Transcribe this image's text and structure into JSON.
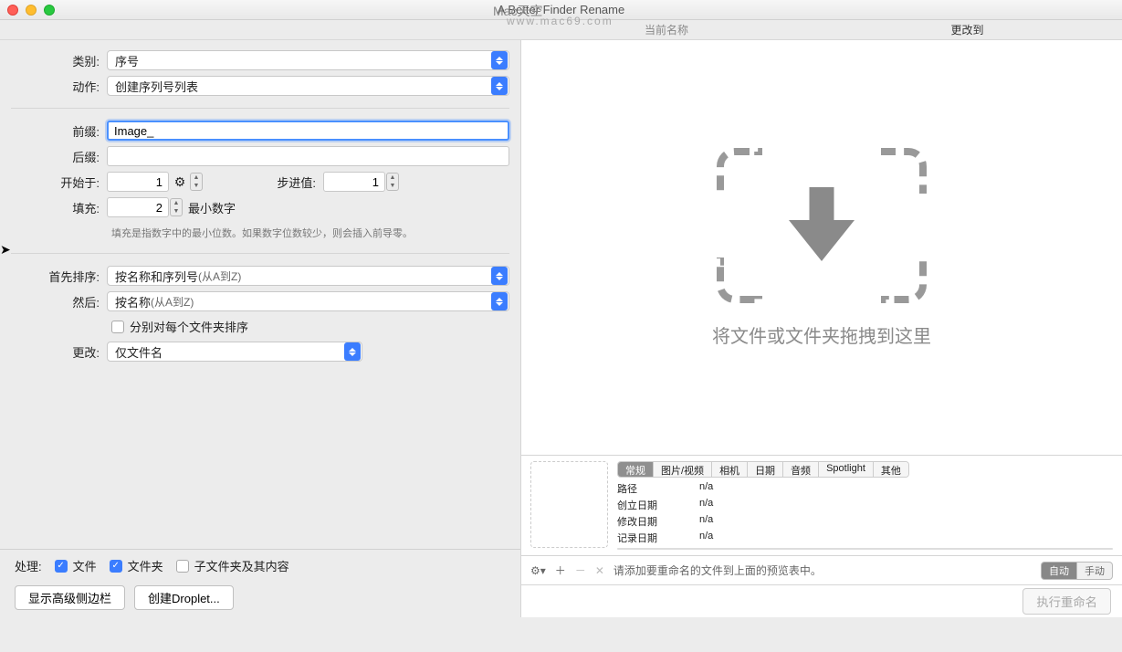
{
  "window": {
    "title": "A Better Finder Rename"
  },
  "watermark": {
    "line1": "Mac天空",
    "line2": "www.mac69.com"
  },
  "header": {
    "current_name": "当前名称",
    "change_to": "更改到"
  },
  "form": {
    "category_label": "类别:",
    "category_value": "序号",
    "action_label": "动作:",
    "action_value": "创建序列号列表",
    "prefix_label": "前缀:",
    "prefix_value": "Image_",
    "suffix_label": "后缀:",
    "suffix_value": "",
    "start_label": "开始于:",
    "start_value": "1",
    "step_label": "步进值:",
    "step_value": "1",
    "fill_label": "填充:",
    "fill_value": "2",
    "fill_unit": "最小数字",
    "hint": "填充是指数字中的最小位数。如果数字位数较少，则会插入前导零。",
    "sort1_label": "首先排序:",
    "sort1_value": "按名称和序列号",
    "sort1_sub": "(从A到Z)",
    "sort2_label": "然后:",
    "sort2_value": "按名称",
    "sort2_sub": "(从A到Z)",
    "sort_each_folder": "分别对每个文件夹排序",
    "change_label": "更改:",
    "change_value": "仅文件名"
  },
  "bottom": {
    "process_label": "处理:",
    "files": "文件",
    "folders": "文件夹",
    "subfolders": "子文件夹及其内容",
    "show_sidebar": "显示高级侧边栏",
    "create_droplet": "创建Droplet..."
  },
  "dropzone": {
    "text": "将文件或文件夹拖拽到这里"
  },
  "tabs": [
    "常规",
    "图片/视频",
    "相机",
    "日期",
    "音频",
    "Spotlight",
    "其他"
  ],
  "info": {
    "path": "路径",
    "path_v": "n/a",
    "created": "创立日期",
    "created_v": "n/a",
    "modified": "修改日期",
    "modified_v": "n/a",
    "recorded": "记录日期",
    "recorded_v": "n/a"
  },
  "actionbar": {
    "hint": "请添加要重命名的文件到上面的预览表中。",
    "auto": "自动",
    "manual": "手动"
  },
  "exec": "执行重命名"
}
